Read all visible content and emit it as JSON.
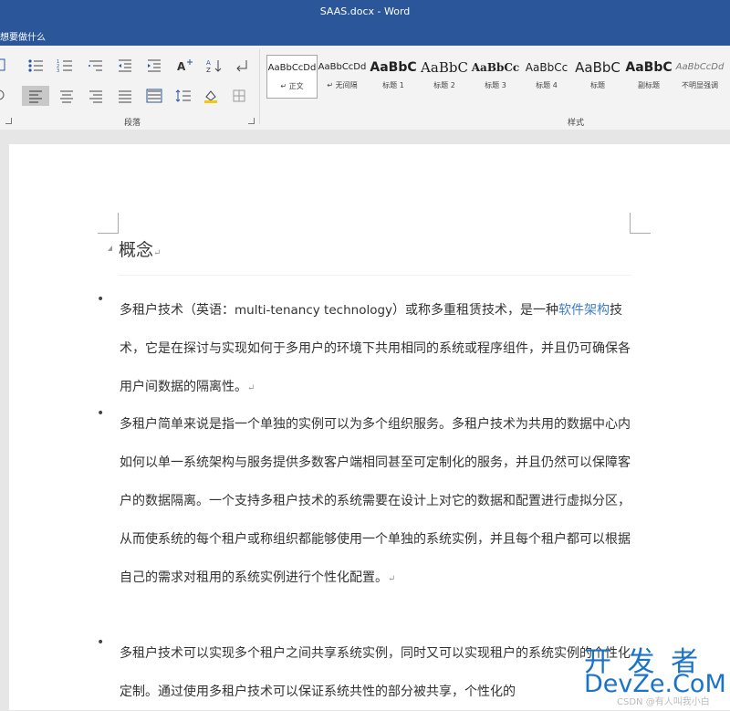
{
  "window": {
    "title": "SAAS.docx - Word"
  },
  "tellme": {
    "text": "想要做什么"
  },
  "ribbon": {
    "group_paragraph": "段落",
    "group_styles": "样式",
    "styles": [
      {
        "preview": "AaBbCcDd",
        "name": "↵ 正文",
        "selected": true
      },
      {
        "preview": "AaBbCcDd",
        "name": "↵ 无间隔"
      },
      {
        "preview": "AaBbC",
        "name": "标题 1"
      },
      {
        "preview": "AaBbC",
        "name": "标题 2"
      },
      {
        "preview": "AaBbCc",
        "name": "标题 3"
      },
      {
        "preview": "AaBbCc",
        "name": "标题 4"
      },
      {
        "preview": "AaBbC",
        "name": "标题"
      },
      {
        "preview": "AaBbC",
        "name": "副标题"
      },
      {
        "preview": "AaBbCcDd",
        "name": "不明显强调"
      }
    ]
  },
  "document": {
    "heading": "概念",
    "p1": {
      "a": "多租户技术（英语：",
      "en": "multi-tenancy technology",
      "b": "）或称多重租赁技术，是一种",
      "link": "软件架构",
      "c": "技术，它是在探讨与实现如何于多用户的环境下共用相同的系统或程序组件，并且仍可确保各用户间数据的隔离性。"
    },
    "p2": "多租户简单来说是指一个单独的实例可以为多个组织服务。多租户技术为共用的数据中心内如何以单一系统架构与服务提供多数客户端相同甚至可定制化的服务，并且仍然可以保障客户的数据隔离。一个支持多租户技术的系统需要在设计上对它的数据和配置进行虚拟分区，从而使系统的每个租户或称组织都能够使用一个单独的系统实例，并且每个租户都可以根据自己的需求对租用的系统实例进行个性化配置。",
    "p3": "多租户技术可以实现多个租户之间共享系统实例，同时又可以实现租户的系统实例的个性化定制。通过使用多租户技术可以保证系统共性的部分被共享，个性化的",
    "bullet": "•",
    "para_mark": "↵"
  },
  "watermark": {
    "line1": "开 发 者",
    "line2": "DevZe.CoM",
    "line3": "CSDN @有人叫我小白"
  }
}
